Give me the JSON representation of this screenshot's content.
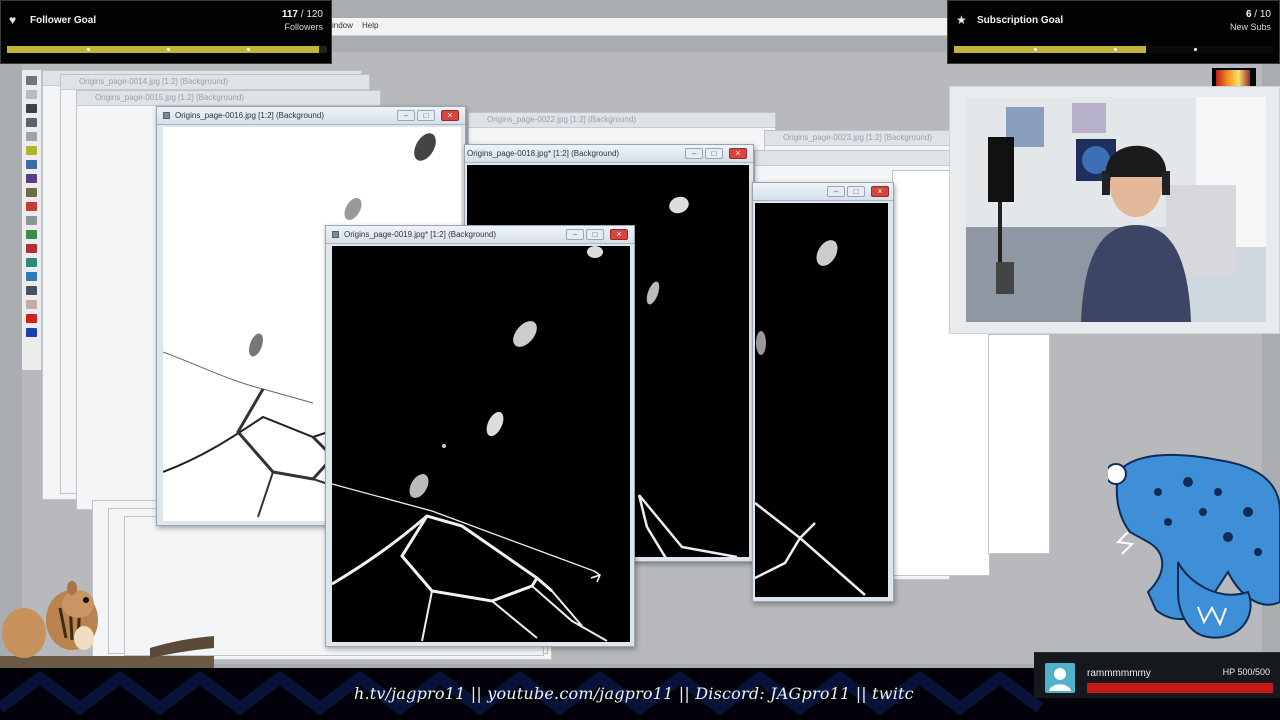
{
  "app": {
    "menu": [
      "indow",
      "Help"
    ],
    "tools": [
      "zoom-tool",
      "marquee-tool",
      "crop-tool",
      "move-tool",
      "rectangle-tool",
      "lasso-tool",
      "eyedropper-tool",
      "brush-tool",
      "pencil-tool",
      "clone-tool",
      "eraser-tool",
      "fill-tool",
      "retouch-tool",
      "color-replacer-tool",
      "text-tool",
      "shape-tool",
      "pen-tool",
      "foreground-color",
      "background-color"
    ]
  },
  "ghost_windows": [
    {
      "title": "Origins_page-0014.jpg [1:2] (Background)"
    },
    {
      "title": "Origins_page-0015.jpg [1:2] (Background)"
    },
    {
      "title": "Origins_page-0022.jpg [1:2] (Background)"
    },
    {
      "title": "Origins_page-0023.jpg [1:2] (Background)"
    }
  ],
  "windows": [
    {
      "title": "Origins_page-0016.jpg [1:2] (Background)"
    },
    {
      "title": "Origins_page-0018.jpg* [1:2] (Background)"
    },
    {
      "title": "Origins_page-0019.jpg* [1:2] (Background)"
    }
  ],
  "follower_goal": {
    "label": "Follower Goal",
    "current": "117",
    "sep": " / ",
    "target": "120",
    "unit": "Followers",
    "progress": 0.975
  },
  "subscription_goal": {
    "label": "Subscription Goal",
    "current": "6",
    "sep": " / ",
    "target": "10",
    "unit": "New Subs",
    "progress": 0.6
  },
  "ticker": {
    "text": "h.tv/jagpro11   ||   youtube.com/jagpro11   ||   Discord: JAGpro11   ||   twitc"
  },
  "hp_widget": {
    "username": "rammmmmmy",
    "hp_label": "HP 500/500",
    "hp_fraction": 1.0
  },
  "colors": {
    "goal_fill": "#c2b33a",
    "hp_fill": "#c81717",
    "hp_avatar": "#4fb2c9",
    "leopard_blue": "#3f8fd8"
  },
  "icons": [
    "heart-hand-icon",
    "star-icon",
    "minimize-icon",
    "maximize-icon",
    "close-icon",
    "user-avatar-icon"
  ]
}
